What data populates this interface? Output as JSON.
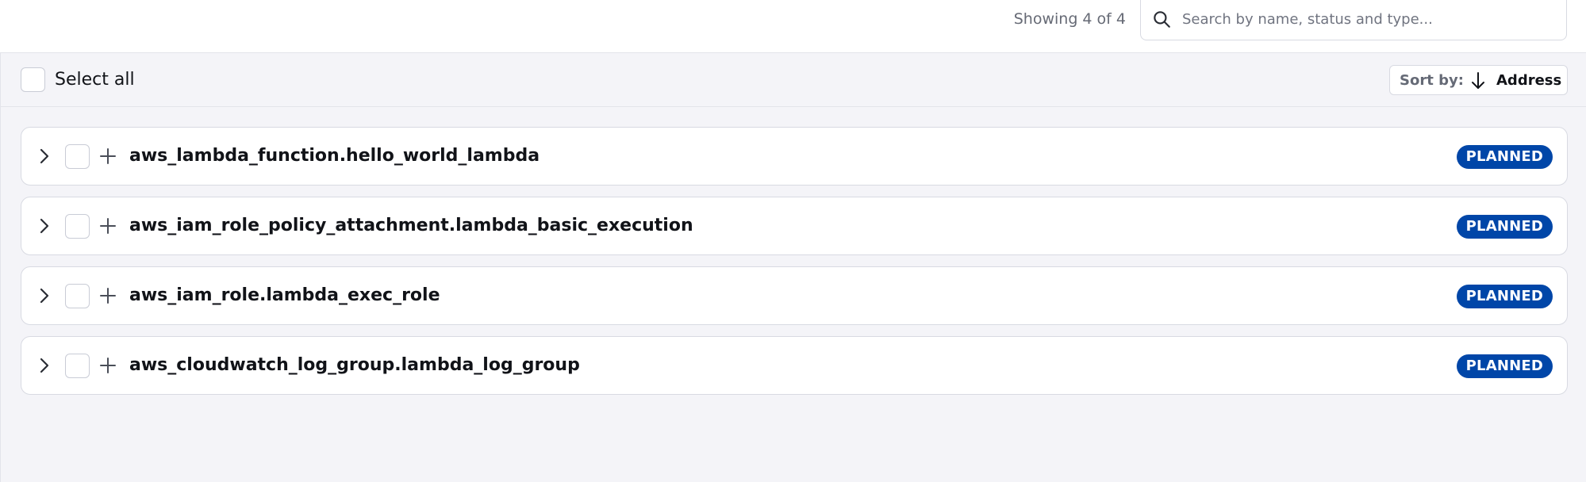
{
  "header": {
    "showing_text": "Showing 4 of 4",
    "search": {
      "placeholder": "Search by name, status and type...",
      "value": ""
    }
  },
  "toolbar": {
    "select_all_label": "Select all",
    "sort_prefix": "Sort by:",
    "sort_value": "Address",
    "sort_direction_icon": "arrow-down-icon"
  },
  "resources": [
    {
      "address": "aws_lambda_function.hello_world_lambda",
      "status": "PLANNED",
      "action_icon": "plus-icon"
    },
    {
      "address": "aws_iam_role_policy_attachment.lambda_basic_execution",
      "status": "PLANNED",
      "action_icon": "plus-icon"
    },
    {
      "address": "aws_iam_role.lambda_exec_role",
      "status": "PLANNED",
      "action_icon": "plus-icon"
    },
    {
      "address": "aws_cloudwatch_log_group.lambda_log_group",
      "status": "PLANNED",
      "action_icon": "plus-icon"
    }
  ],
  "colors": {
    "badge_background": "#0046a8",
    "panel_background": "#f4f4f8",
    "border": "#d8dae2"
  }
}
